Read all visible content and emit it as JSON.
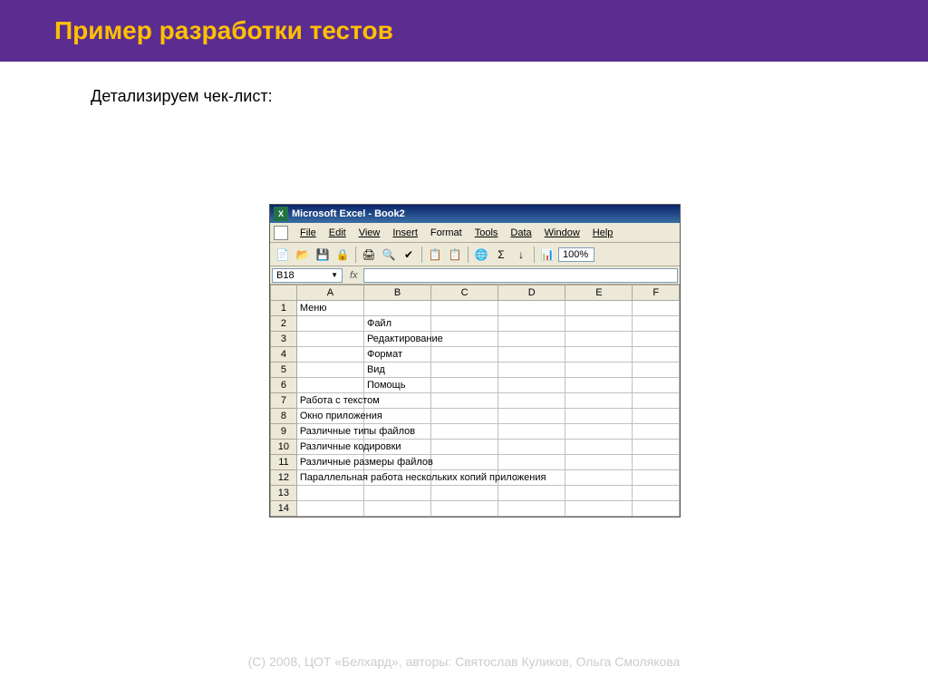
{
  "slide": {
    "title": "Пример разработки тестов",
    "subtitle": "Детализируем чек-лист:",
    "footer": "(C) 2008, ЦОТ «Белхард», авторы: Святослав Куликов, Ольга Смолякова"
  },
  "excel": {
    "app_icon_text": "X",
    "title": "Microsoft Excel - Book2",
    "menu": {
      "file": "File",
      "edit": "Edit",
      "view": "View",
      "insert": "Insert",
      "format": "Format",
      "tools": "Tools",
      "data": "Data",
      "window": "Window",
      "help": "Help"
    },
    "toolbar": {
      "zoom": "100%"
    },
    "namebox": "B18",
    "fx": "fx",
    "columns": [
      "A",
      "B",
      "C",
      "D",
      "E",
      "F"
    ],
    "rows": [
      {
        "n": "1",
        "A": "Меню"
      },
      {
        "n": "2",
        "B": "Файл"
      },
      {
        "n": "3",
        "B": "Редактирование"
      },
      {
        "n": "4",
        "B": "Формат"
      },
      {
        "n": "5",
        "B": "Вид"
      },
      {
        "n": "6",
        "B": "Помощь"
      },
      {
        "n": "7",
        "A": "Работа с текстом"
      },
      {
        "n": "8",
        "A": "Окно приложения"
      },
      {
        "n": "9",
        "A": "Различные типы файлов"
      },
      {
        "n": "10",
        "A": "Различные кодировки"
      },
      {
        "n": "11",
        "A": "Различные размеры файлов"
      },
      {
        "n": "12",
        "A": "Параллельная работа нескольких копий приложения"
      },
      {
        "n": "13"
      },
      {
        "n": "14"
      }
    ]
  }
}
